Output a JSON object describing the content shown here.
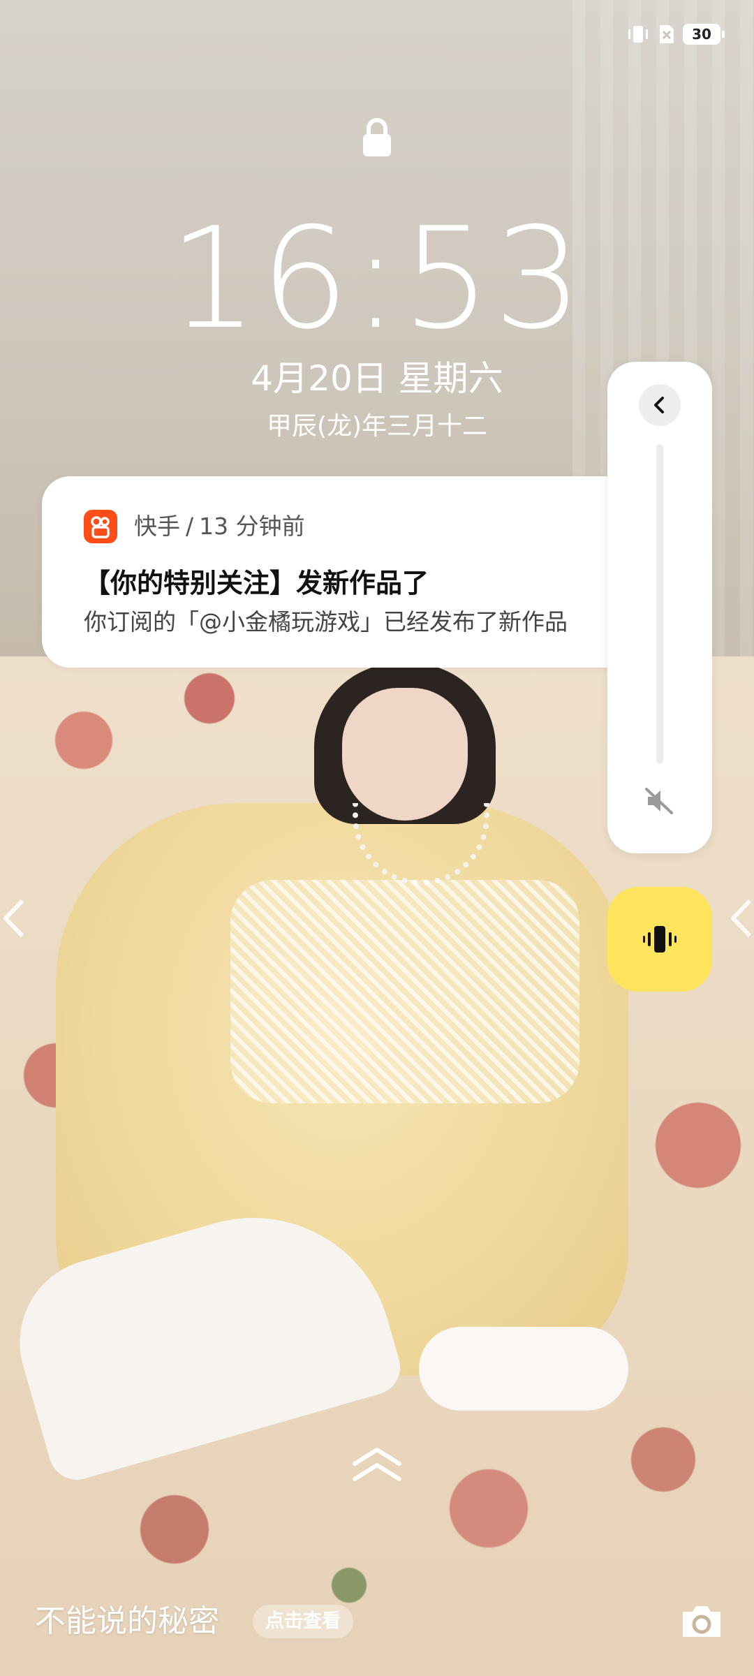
{
  "status_bar": {
    "battery_level": "30",
    "icons": [
      "vibrate-icon",
      "no-sim-icon",
      "battery-icon"
    ]
  },
  "lock_screen": {
    "time": "16:53",
    "date": "4月20日 星期六",
    "lunar_date": "甲辰(龙)年三月十二"
  },
  "notification": {
    "app_name": "快手",
    "separator": "/",
    "time_ago": "13 分钟前",
    "title": "【你的特别关注】发新作品了",
    "body": "你订阅的「@小金橘玩游戏」已经发布了新作品"
  },
  "volume_panel": {
    "level": 0,
    "mode": "vibrate",
    "accent": "#fce55c"
  },
  "wallpaper": {
    "caption": "不能说的秘密",
    "view_button": "点击查看"
  },
  "colors": {
    "app_icon": "#ff4d1a",
    "vibrate_button": "#fce55c"
  }
}
